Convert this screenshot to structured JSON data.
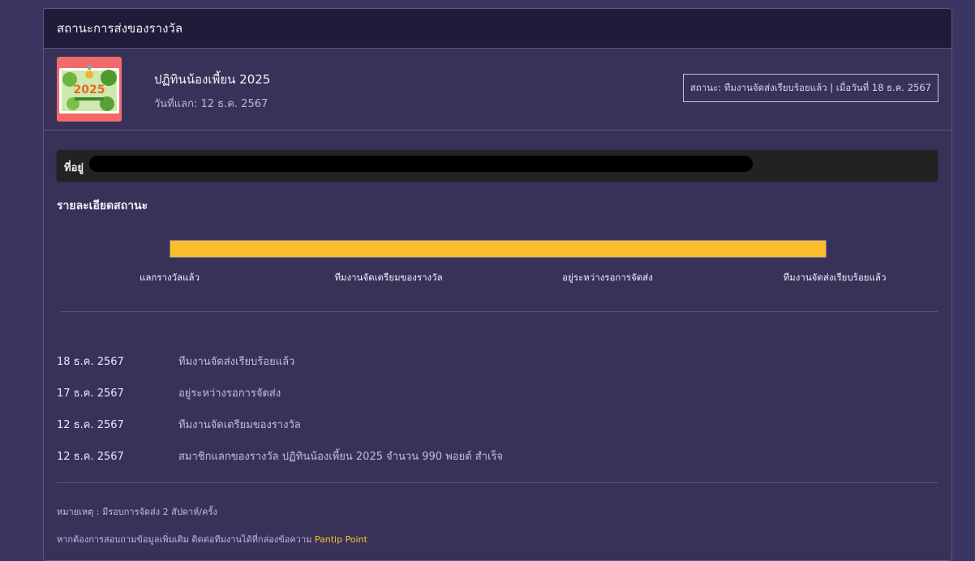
{
  "header": {
    "title": "สถานะการส่งของรางวัล"
  },
  "item": {
    "name": "ปฏิทินน้องเพี้ยน 2025",
    "redeem_date": "วันที่แลก: 12 ธ.ค. 2567",
    "status": "สถานะ: ทีมงานจัดส่งเรียบร้อยแล้ว | เมื่อวันที่ 18 ธ.ค. 2567",
    "thumb_bg": "#f26a6a",
    "thumb_text": "2025"
  },
  "address": {
    "label": "ที่อยู่"
  },
  "progress": {
    "title": "รายละเอียดสถานะ",
    "percent": 100,
    "fill_color": "#fbbd2b",
    "steps": [
      "แลกรางวัลแล้ว",
      "ทีมงานจัดเตรียมของรางวัล",
      "อยู่ระหว่างรอการจัดส่ง",
      "ทีมงานจัดส่งเรียบร้อยแล้ว"
    ]
  },
  "history": [
    {
      "date": "18 ธ.ค. 2567",
      "text": "ทีมงานจัดส่งเรียบร้อยแล้ว"
    },
    {
      "date": "17 ธ.ค. 2567",
      "text": "อยู่ระหว่างรอการจัดส่ง"
    },
    {
      "date": "12 ธ.ค. 2567",
      "text": "ทีมงานจัดเตรียมของรางวัล"
    },
    {
      "date": "12 ธ.ค. 2567",
      "text": "สมาชิกแลกของรางวัล ปฏิทินน้องเพี้ยน 2025 จำนวน 990 พอยต์ สำเร็จ"
    }
  ],
  "notes": {
    "remark": "หมายเหตุ : มีรอบการจัดส่ง 2 สัปดาห์/ครั้ง",
    "contact_prefix": "หากต้องการสอบถามข้อมูลเพิ่มเติม ติดต่อทีมงานได้ที่กล่องข้อความ",
    "contact_link": "Pantip Point"
  },
  "colors": {
    "page_bg": "#3b3561",
    "panel_bg": "#393258",
    "header_bg": "#1f1c39",
    "accent_link": "#f7c62f"
  }
}
